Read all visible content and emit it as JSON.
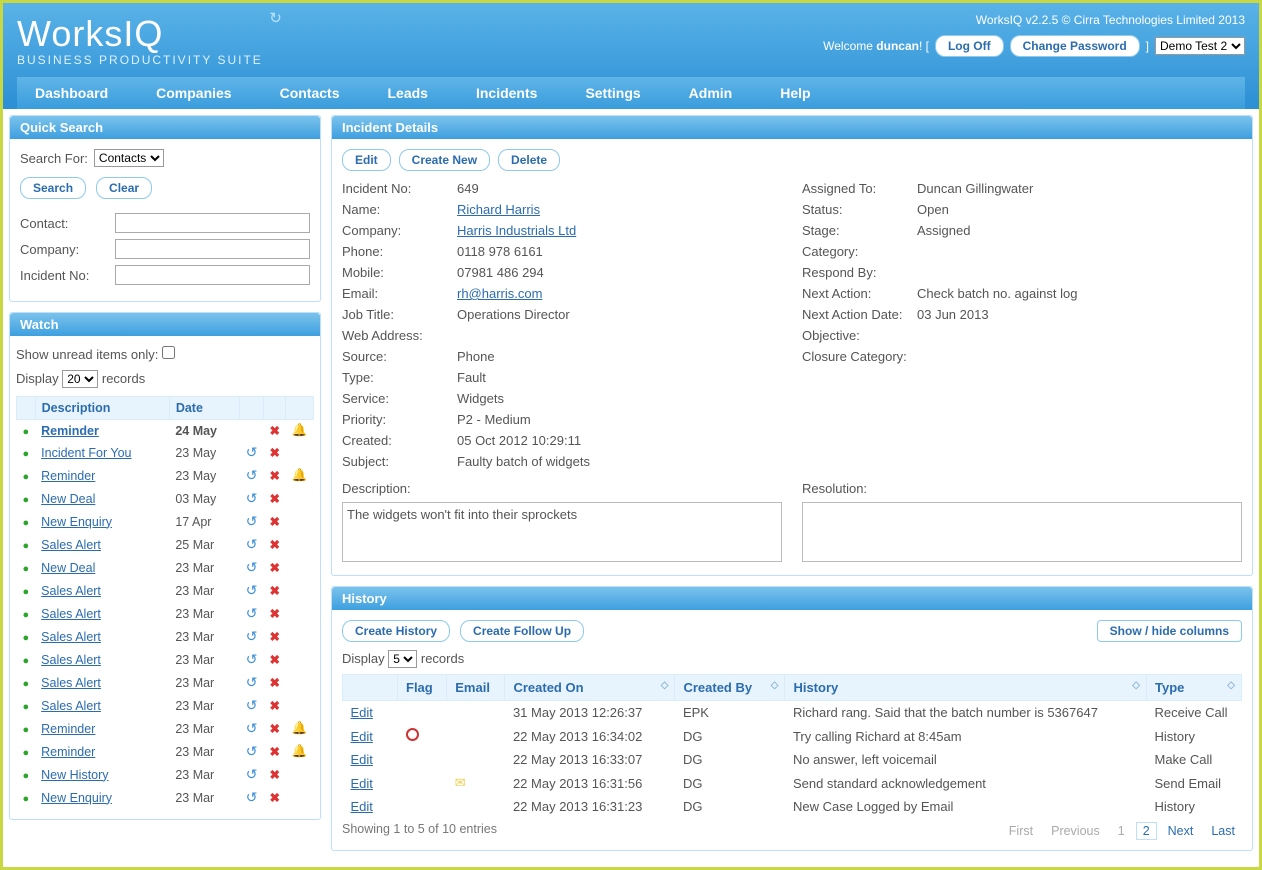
{
  "header": {
    "logo": "WorksIQ",
    "tagline": "BUSINESS PRODUCTIVITY SUITE",
    "version": "WorksIQ v2.2.5 © Cirra Technologies Limited 2013",
    "welcome_prefix": "Welcome ",
    "user": "duncan",
    "log_off": "Log Off",
    "change_pw": "Change Password",
    "tenant": "Demo Test 2"
  },
  "nav": [
    "Dashboard",
    "Companies",
    "Contacts",
    "Leads",
    "Incidents",
    "Settings",
    "Admin",
    "Help"
  ],
  "quick_search": {
    "title": "Quick Search",
    "search_for_lbl": "Search For:",
    "search_for_val": "Contacts",
    "search_btn": "Search",
    "clear_btn": "Clear",
    "contact_lbl": "Contact:",
    "company_lbl": "Company:",
    "incident_lbl": "Incident No:"
  },
  "watch": {
    "title": "Watch",
    "unread_lbl": "Show unread items only:",
    "display_lbl": "Display",
    "display_val": "20",
    "records_lbl": "records",
    "col_desc": "Description",
    "col_date": "Date",
    "rows": [
      {
        "desc": "Reminder",
        "date": "24 May",
        "bold": true,
        "undo": false,
        "del": true,
        "bell": true
      },
      {
        "desc": "Incident For You",
        "date": "23 May",
        "bold": false,
        "undo": true,
        "del": true,
        "bell": false
      },
      {
        "desc": "Reminder",
        "date": "23 May",
        "bold": false,
        "undo": true,
        "del": true,
        "bell": true
      },
      {
        "desc": "New Deal",
        "date": "03 May",
        "bold": false,
        "undo": true,
        "del": true,
        "bell": false
      },
      {
        "desc": "New Enquiry",
        "date": "17 Apr",
        "bold": false,
        "undo": true,
        "del": true,
        "bell": false
      },
      {
        "desc": "Sales Alert",
        "date": "25 Mar",
        "bold": false,
        "undo": true,
        "del": true,
        "bell": false
      },
      {
        "desc": "New Deal",
        "date": "23 Mar",
        "bold": false,
        "undo": true,
        "del": true,
        "bell": false
      },
      {
        "desc": "Sales Alert",
        "date": "23 Mar",
        "bold": false,
        "undo": true,
        "del": true,
        "bell": false
      },
      {
        "desc": "Sales Alert",
        "date": "23 Mar",
        "bold": false,
        "undo": true,
        "del": true,
        "bell": false
      },
      {
        "desc": "Sales Alert",
        "date": "23 Mar",
        "bold": false,
        "undo": true,
        "del": true,
        "bell": false
      },
      {
        "desc": "Sales Alert",
        "date": "23 Mar",
        "bold": false,
        "undo": true,
        "del": true,
        "bell": false
      },
      {
        "desc": "Sales Alert",
        "date": "23 Mar",
        "bold": false,
        "undo": true,
        "del": true,
        "bell": false
      },
      {
        "desc": "Sales Alert",
        "date": "23 Mar",
        "bold": false,
        "undo": true,
        "del": true,
        "bell": false
      },
      {
        "desc": "Reminder",
        "date": "23 Mar",
        "bold": false,
        "undo": true,
        "del": true,
        "bell": true
      },
      {
        "desc": "Reminder",
        "date": "23 Mar",
        "bold": false,
        "undo": true,
        "del": true,
        "bell": true
      },
      {
        "desc": "New History",
        "date": "23 Mar",
        "bold": false,
        "undo": true,
        "del": true,
        "bell": false
      },
      {
        "desc": "New Enquiry",
        "date": "23 Mar",
        "bold": false,
        "undo": true,
        "del": true,
        "bell": false
      }
    ]
  },
  "incident": {
    "title": "Incident Details",
    "edit_btn": "Edit",
    "create_btn": "Create New",
    "delete_btn": "Delete",
    "left": [
      {
        "lbl": "Incident No:",
        "val": "649",
        "link": false
      },
      {
        "lbl": "Name:",
        "val": "Richard Harris",
        "link": true
      },
      {
        "lbl": "Company:",
        "val": "Harris Industrials Ltd",
        "link": true
      },
      {
        "lbl": "Phone:",
        "val": "0118 978 6161",
        "link": false
      },
      {
        "lbl": "Mobile:",
        "val": "07981 486 294",
        "link": false
      },
      {
        "lbl": "Email:",
        "val": "rh@harris.com",
        "link": true
      },
      {
        "lbl": "Job Title:",
        "val": "Operations Director",
        "link": false
      },
      {
        "lbl": "Web Address:",
        "val": "",
        "link": false
      },
      {
        "lbl": "Source:",
        "val": "Phone",
        "link": false
      },
      {
        "lbl": "Type:",
        "val": "Fault",
        "link": false
      },
      {
        "lbl": "Service:",
        "val": "Widgets",
        "link": false
      },
      {
        "lbl": "Priority:",
        "val": "P2 - Medium",
        "link": false
      },
      {
        "lbl": "Created:",
        "val": "05 Oct 2012 10:29:11",
        "link": false
      },
      {
        "lbl": "Subject:",
        "val": "Faulty batch of widgets",
        "link": false
      }
    ],
    "right": [
      {
        "lbl": "Assigned To:",
        "val": "Duncan Gillingwater"
      },
      {
        "lbl": "Status:",
        "val": "Open"
      },
      {
        "lbl": "Stage:",
        "val": "Assigned"
      },
      {
        "lbl": "Category:",
        "val": ""
      },
      {
        "lbl": "Respond By:",
        "val": ""
      },
      {
        "lbl": "Next Action:",
        "val": "Check batch no. against log"
      },
      {
        "lbl": "Next Action Date:",
        "val": "03 Jun 2013"
      },
      {
        "lbl": "Objective:",
        "val": ""
      },
      {
        "lbl": "Closure Category:",
        "val": ""
      }
    ],
    "description_lbl": "Description:",
    "description_val": "The widgets won't fit into their sprockets",
    "resolution_lbl": "Resolution:",
    "resolution_val": ""
  },
  "history": {
    "title": "History",
    "create_hist": "Create History",
    "create_follow": "Create Follow Up",
    "display_lbl": "Display",
    "display_val": "5",
    "records_lbl": "records",
    "show_hide": "Show / hide columns",
    "cols": {
      "edit": "",
      "flag": "Flag",
      "email": "Email",
      "created_on": "Created On",
      "created_by": "Created By",
      "history": "History",
      "type": "Type"
    },
    "rows": [
      {
        "flag": "",
        "email": "",
        "created_on": "31 May 2013 12:26:37",
        "created_by": "EPK",
        "history": "Richard rang. Said that the batch number is 5367647",
        "type": "Receive Call"
      },
      {
        "flag": "clock",
        "email": "",
        "created_on": "22 May 2013 16:34:02",
        "created_by": "DG",
        "history": "Try calling Richard at 8:45am",
        "type": "History"
      },
      {
        "flag": "",
        "email": "",
        "created_on": "22 May 2013 16:33:07",
        "created_by": "DG",
        "history": "No answer, left voicemail",
        "type": "Make Call"
      },
      {
        "flag": "",
        "email": "env",
        "created_on": "22 May 2013 16:31:56",
        "created_by": "DG",
        "history": "Send standard acknowledgement",
        "type": "Send Email"
      },
      {
        "flag": "",
        "email": "",
        "created_on": "22 May 2013 16:31:23",
        "created_by": "DG",
        "history": "New Case Logged by Email",
        "type": "History"
      }
    ],
    "edit_lbl": "Edit",
    "showing": "Showing 1 to 5 of 10 entries",
    "pager": {
      "first": "First",
      "prev": "Previous",
      "p1": "1",
      "p2": "2",
      "next": "Next",
      "last": "Last"
    }
  }
}
